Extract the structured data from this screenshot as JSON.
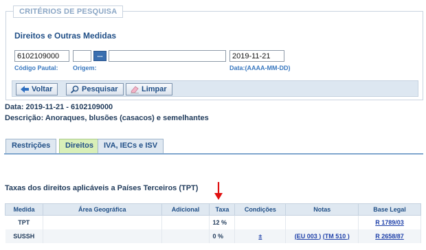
{
  "search": {
    "legend": "CRITÉRIOS DE PESQUISA",
    "section_title": "Direitos e Outras Medidas",
    "code_value": "6102109000",
    "origin_value": "",
    "origin_desc_value": "",
    "date_value": "2019-11-21",
    "dots_label": "...",
    "code_label": "Código Pautal:",
    "origin_label": "Origem:",
    "date_label": "Data:(AAAA-MM-DD)"
  },
  "buttons": {
    "back": "Voltar",
    "search": "Pesquisar",
    "clear": "Limpar"
  },
  "info": {
    "date_line": "Data: 2019-11-21 - 6102109000",
    "description": "Descrição: Anoraques, blusões (casacos) e semelhantes"
  },
  "tabs": [
    {
      "label": "Restrições",
      "active": false
    },
    {
      "label": "Direitos",
      "active": true
    },
    {
      "label": "IVA, IECs e ISV",
      "active": false
    }
  ],
  "table": {
    "title": "Taxas dos direitos aplicáveis a Países Terceiros (TPT)",
    "headers": [
      "Medida",
      "Área Geográfica",
      "Adicional",
      "Taxa",
      "Condições",
      "Notas",
      "Base Legal"
    ],
    "rows": [
      {
        "medida": "TPT",
        "area": "",
        "adicional": "",
        "taxa": "12 %",
        "condicoes": "",
        "nota1": "",
        "nota2": "",
        "base": "R 1789/03"
      },
      {
        "medida": "SUSSH",
        "area": "",
        "adicional": "",
        "taxa": "0 %",
        "condicoes": "±",
        "nota1": "(EU 003 )",
        "nota2": "(TM 510 )",
        "base": "R 2658/87"
      }
    ]
  },
  "colors": {
    "accent": "#1f4e86",
    "arrow": "#e01010",
    "active_tab": "#d9efb8"
  },
  "icons": {
    "back": "arrow-left-icon",
    "search": "magnifier-icon",
    "clear": "eraser-icon",
    "annotation": "red-down-arrow"
  }
}
